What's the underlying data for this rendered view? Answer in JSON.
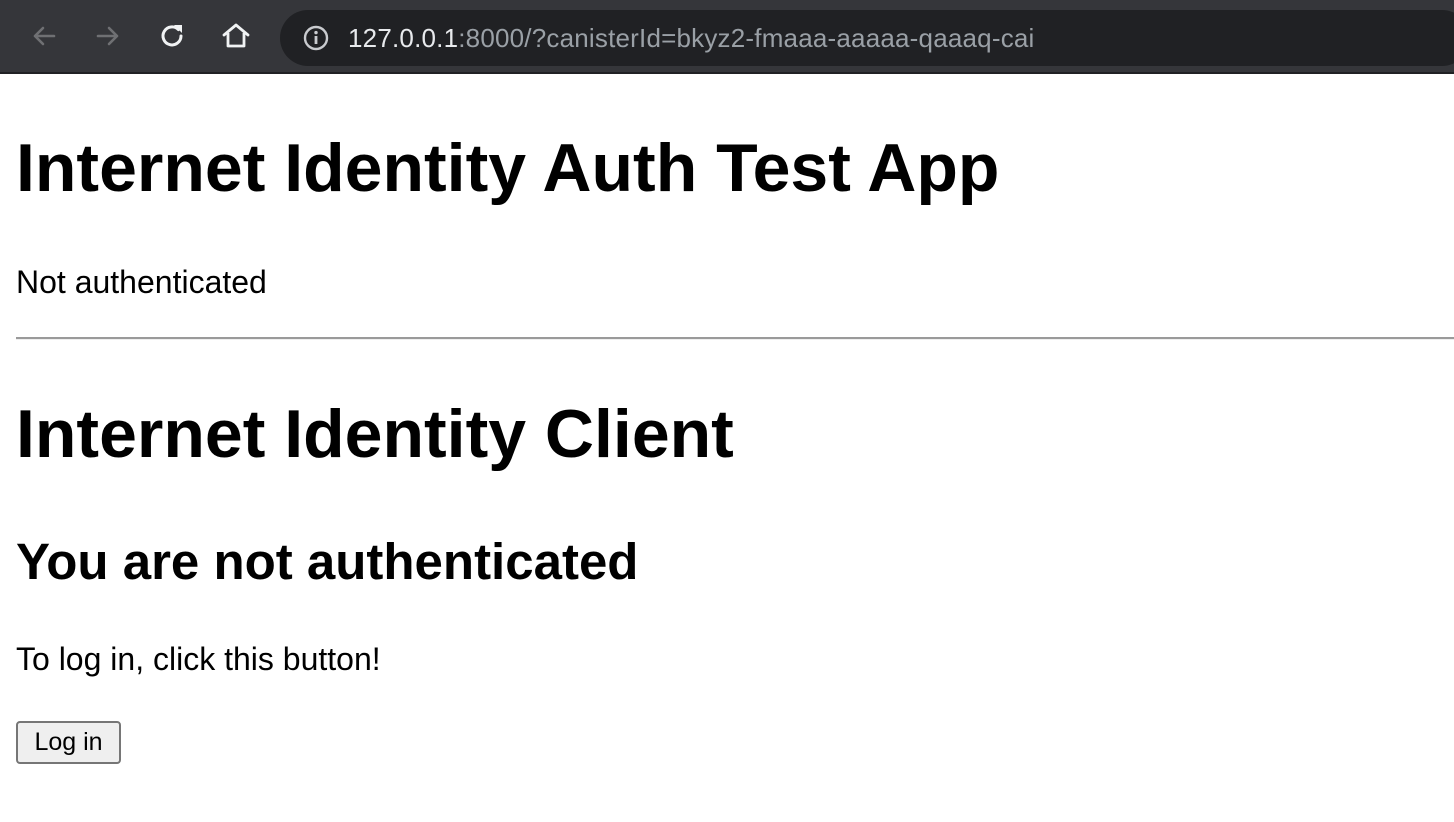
{
  "browser": {
    "url_host": "127.0.0.1",
    "url_rest": ":8000/?canisterId=bkyz2-fmaaa-aaaaa-qaaaq-cai",
    "icons": {
      "back": "arrow-left-icon",
      "forward": "arrow-right-icon",
      "reload": "reload-icon",
      "home": "home-icon",
      "site_info": "info-circle-icon"
    },
    "colors": {
      "toolbar": "#35363a",
      "omnibox": "#202124",
      "host_text": "#e8eaed",
      "path_text": "#9aa0a6"
    }
  },
  "page": {
    "app_title": "Internet Identity Auth Test App",
    "auth_status": "Not authenticated",
    "client_title": "Internet Identity Client",
    "not_auth_heading": "You are not authenticated",
    "login_instructions": "To log in, click this button!",
    "login_button_label": "Log in"
  }
}
